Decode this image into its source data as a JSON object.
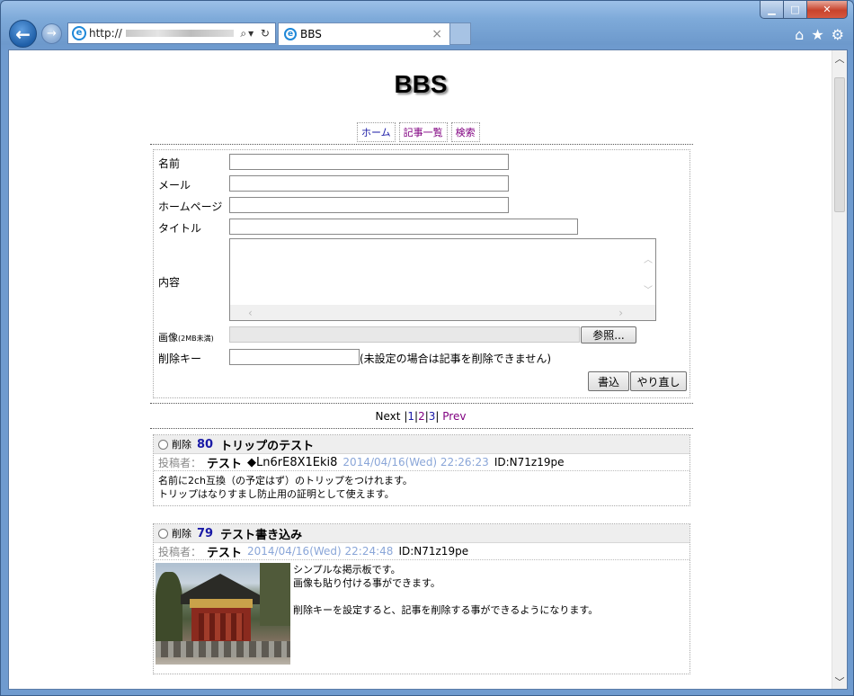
{
  "browser": {
    "address_prefix": "http://",
    "tab_title": "BBS",
    "tab_close": "×",
    "window_buttons": {
      "minimize": "▁",
      "maximize": "□",
      "close": "✕"
    },
    "toolbar_icons": [
      "home-icon",
      "star-icon",
      "gear-icon"
    ]
  },
  "page": {
    "title": "BBS",
    "menu": [
      {
        "label": "ホーム"
      },
      {
        "label": "記事一覧"
      },
      {
        "label": "検索"
      }
    ]
  },
  "form": {
    "name_label": "名前",
    "mail_label": "メール",
    "homepage_label": "ホームページ",
    "title_label": "タイトル",
    "content_label": "内容",
    "image_label": "画像",
    "image_note": "(2MB未満)",
    "browse_button": "参照...",
    "delkey_label": "削除キー",
    "delkey_note": "(未設定の場合は記事を削除できません)",
    "submit_button": "書込",
    "reset_button": "やり直し",
    "values": {
      "name": "",
      "mail": "",
      "homepage": "",
      "title": "",
      "content": "",
      "delkey": ""
    }
  },
  "pager": {
    "next": "Next",
    "sep_left": "|",
    "pages": [
      "1",
      "2",
      "3"
    ],
    "sep_right": "|",
    "prev": "Prev"
  },
  "posts": [
    {
      "delete_label": "削除",
      "number": "80",
      "title": "トリップのテスト",
      "poster_label": "投稿者：",
      "name": "テスト",
      "trip": "◆Ln6rE8X1Eki8",
      "date": "2014/04/16(Wed) 22:26:23",
      "id": "ID:N71z19pe",
      "lines": [
        "名前に2ch互換（の予定はず）のトリップをつけれます。",
        "トリップはなりすまし防止用の証明として使えます。"
      ]
    },
    {
      "delete_label": "削除",
      "number": "79",
      "title": "テスト書き込み",
      "poster_label": "投稿者：",
      "name": "テスト",
      "date": "2014/04/16(Wed) 22:24:48",
      "id": "ID:N71z19pe",
      "lines": [
        "シンプルな掲示板です。",
        "画像も貼り付ける事ができます。",
        "",
        "削除キーを設定すると、記事を削除する事ができるようになります。"
      ]
    }
  ]
}
